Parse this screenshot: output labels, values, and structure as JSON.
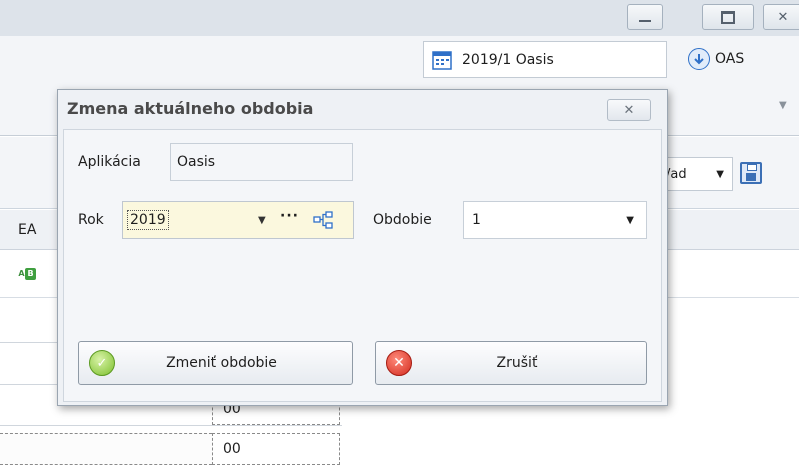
{
  "window": {
    "controls": [
      "minimize-icon",
      "restore-icon",
      "close-icon"
    ]
  },
  "header": {
    "period_value": "2019/1 Oasis",
    "period_icon": "calendar-icon",
    "oas_label": "OAS",
    "oas_icon": "download-circle-icon"
  },
  "toolbar": {
    "view_combo_value": "/ad",
    "save_icon": "save-icon"
  },
  "grid": {
    "column_header": "EA",
    "badge": {
      "a": "A",
      "b": "B"
    },
    "cells": [
      "00",
      "00"
    ]
  },
  "dialog": {
    "title": "Zmena aktuálneho obdobia",
    "close_glyph": "✕",
    "app_label": "Aplikácia",
    "app_value": "Oasis",
    "rok_label": "Rok",
    "rok_value": "2019",
    "rok_dots": "···",
    "obdobie_label": "Obdobie",
    "obdobie_value": "1",
    "confirm_button": "Zmeniť obdobie",
    "cancel_button": "Zrušiť"
  },
  "colors": {
    "accent_blue": "#2f70c8",
    "ok_green": "#7cbf2d",
    "cancel_red": "#d22b1f",
    "rok_highlight": "#fbf8de"
  }
}
